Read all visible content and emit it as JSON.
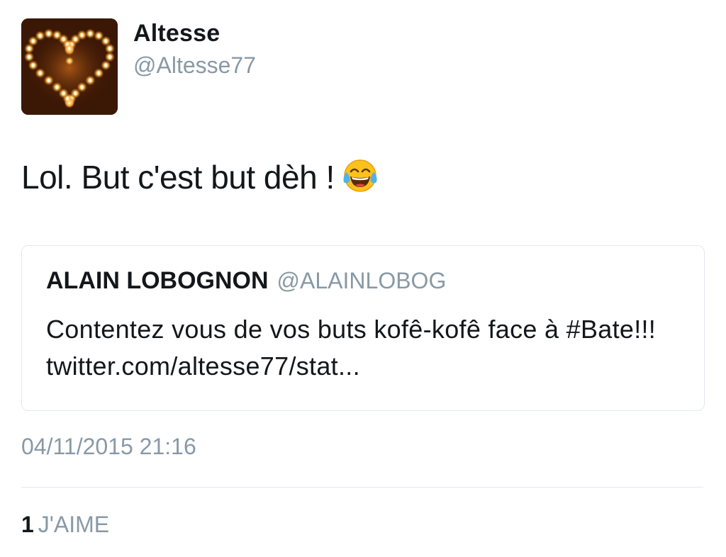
{
  "author": {
    "display_name": "Altesse",
    "handle": "@Altesse77",
    "avatar_icon": "heart-of-candles-icon"
  },
  "tweet": {
    "text": "Lol. But c'est but dèh !",
    "emoji": "face-with-tears-of-joy-icon",
    "timestamp": "04/11/2015 21:16"
  },
  "quoted_tweet": {
    "display_name": "ALAIN LOBOGNON",
    "handle": "@ALAINLOBOG",
    "text": "Contentez vous de vos buts kofê-kofê face à #Bate!!!  twitter.com/altesse77/stat..."
  },
  "stats": {
    "likes_count": "1",
    "likes_label": "J'AIME"
  },
  "colors": {
    "text_primary": "#14171a",
    "text_secondary": "#8899a6",
    "border": "#e1e8ed",
    "background": "#ffffff"
  }
}
